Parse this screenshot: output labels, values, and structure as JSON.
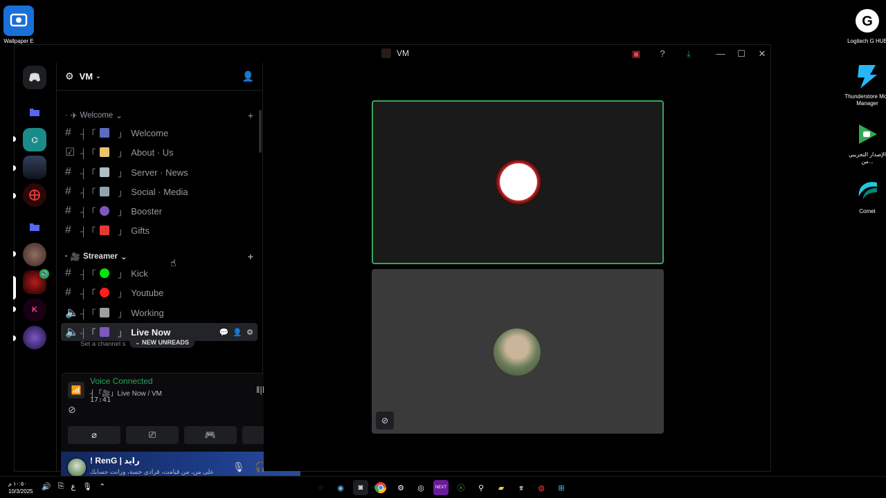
{
  "desktop": {
    "icons_left": [
      {
        "label": "Wallpaper E"
      }
    ],
    "icons_right": [
      {
        "label": "Logitech G HUB"
      },
      {
        "label": "Thunderstore Mod Manager"
      },
      {
        "label": "الإصدار التجريبي من..."
      },
      {
        "label": "Comet"
      }
    ]
  },
  "window": {
    "title": "VM",
    "buttons": [
      "minimize",
      "maximize",
      "close"
    ]
  },
  "server": {
    "name": "VM",
    "categories": [
      {
        "name": "Welcome",
        "channels": [
          {
            "name": "Welcome",
            "type": "text"
          },
          {
            "name": "About · Us",
            "type": "rules"
          },
          {
            "name": "Server · News",
            "type": "text"
          },
          {
            "name": "Social · Media",
            "type": "text"
          },
          {
            "name": "Booster",
            "type": "text"
          },
          {
            "name": "Gifts",
            "type": "text"
          }
        ]
      },
      {
        "name": "Streamer",
        "channels": [
          {
            "name": "Kick",
            "type": "text"
          },
          {
            "name": "Youtube",
            "type": "text"
          },
          {
            "name": "Working",
            "type": "voice"
          },
          {
            "name": "Live Now",
            "type": "voice",
            "active": true
          }
        ]
      }
    ],
    "channel_status_placeholder": "Set a channel s",
    "new_unreads": "NEW UNREADS"
  },
  "voice": {
    "status": "Voice Connected",
    "location": "┤「🎥」Live Now / VM",
    "elapsed": "17:41"
  },
  "user": {
    "name": "! RenG | رايد",
    "status": "علی من، من قیامت، قرادي خسة، وزانت حسابك"
  },
  "taskbar": {
    "time": "١٠:٥٠ م",
    "date": "10/3/2025",
    "lang": "ع"
  },
  "colors": {
    "accent_green": "#23a559",
    "speaking_border": "#3ba55c",
    "user_panel": "#1c3b86"
  }
}
